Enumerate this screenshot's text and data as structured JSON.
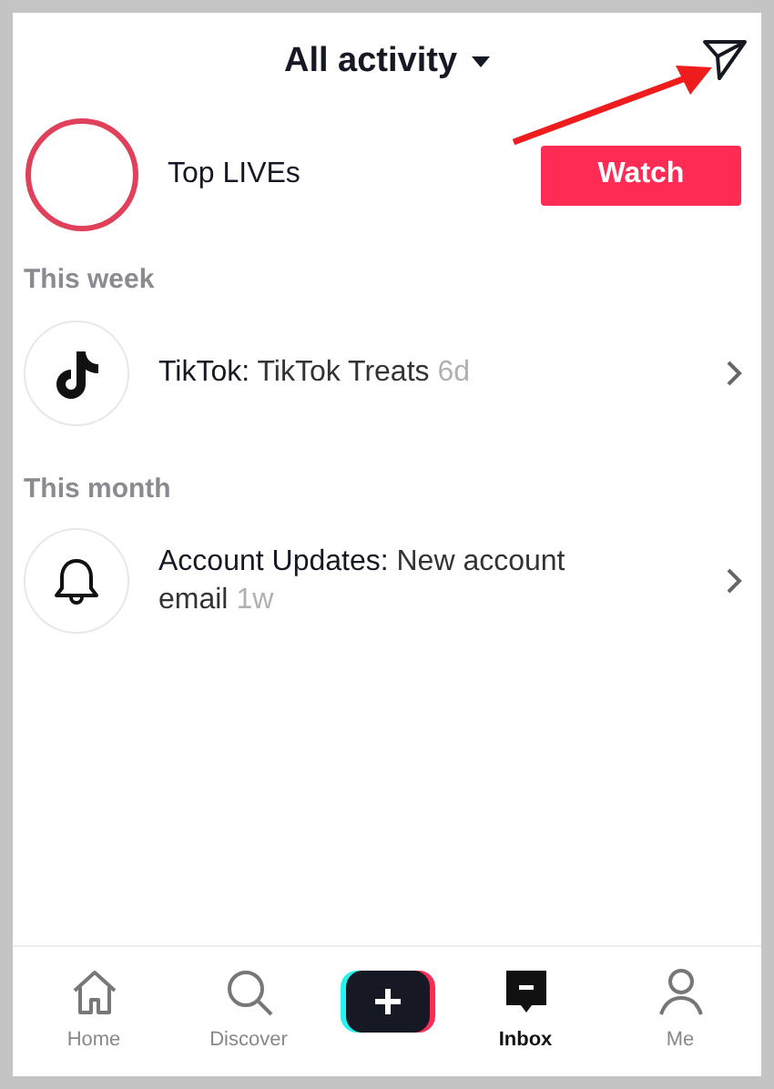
{
  "header": {
    "title": "All activity"
  },
  "live": {
    "label": "Top LIVEs",
    "button": "Watch"
  },
  "sections": [
    {
      "heading": "This week",
      "items": [
        {
          "sender": "TikTok:",
          "message": "TikTok Treats",
          "time": "6d"
        }
      ]
    },
    {
      "heading": "This month",
      "items": [
        {
          "sender": "Account Updates:",
          "message": "New account email",
          "time": "1w"
        }
      ]
    }
  ],
  "nav": [
    {
      "kind": "tab",
      "label": "Home",
      "selected": false
    },
    {
      "kind": "tab",
      "label": "Discover",
      "selected": false
    },
    {
      "kind": "create"
    },
    {
      "kind": "tab",
      "label": "Inbox",
      "selected": true
    },
    {
      "kind": "tab",
      "label": "Me",
      "selected": false
    }
  ]
}
